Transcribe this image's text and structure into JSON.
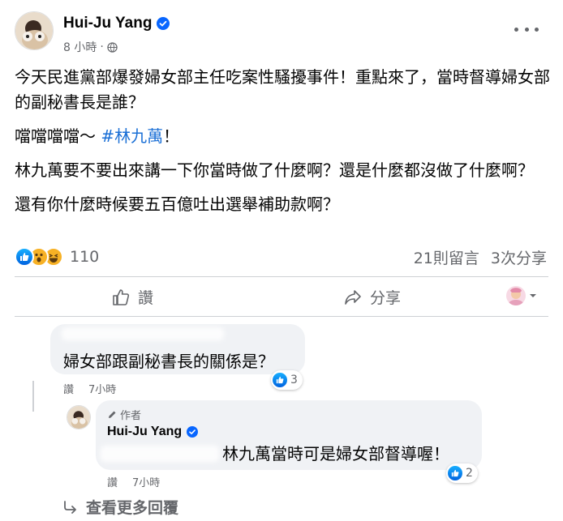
{
  "post": {
    "author": "Hui-Ju Yang",
    "time": "8 小時",
    "dot": "·",
    "paragraph1": "今天民進黨部爆發婦女部主任吃案性騷擾事件！重點來了，當時督導婦女部的副秘書長是誰？",
    "paragraph2_prefix": "噹噹噹噹～ ",
    "paragraph2_hashtag": "#林九萬",
    "paragraph2_suffix": "！",
    "paragraph3": "林九萬要不要出來講一下你當時做了什麼啊？還是什麼都沒做了什麼啊？",
    "paragraph4": "還有你什麼時候要五百億吐出選舉補助款啊？"
  },
  "reactions": {
    "icons": [
      "like-icon",
      "wow-icon",
      "haha-icon"
    ],
    "count": "110",
    "comments": "21則留言",
    "shares": "3次分享"
  },
  "actions": {
    "like_label": "讚",
    "share_label": "分享"
  },
  "comment1": {
    "text": "婦女部跟副秘書長的關係是？",
    "like_label": "讚",
    "time": "7小時",
    "likes": "3"
  },
  "reply1": {
    "author_tag": "作者",
    "author": "Hui-Ju Yang",
    "text": "林九萬當時可是婦女部督導喔！",
    "like_label": "讚",
    "time": "7小時",
    "likes": "2"
  },
  "more_replies": {
    "label": "查看更多回覆"
  },
  "colors": {
    "link": "#1a6fd6",
    "secondary_text": "#65676b",
    "bubble": "#f0f2f5",
    "like_blue": "#0866ff"
  }
}
